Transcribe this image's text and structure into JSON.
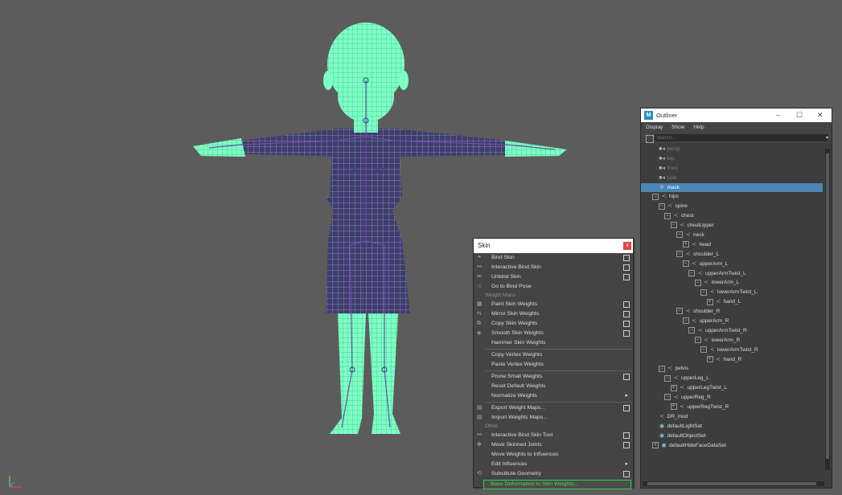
{
  "skin_menu": {
    "title": "Skin",
    "close_label": "x",
    "items": [
      {
        "label": "Bind Skin",
        "icon": "bind-skin-icon",
        "option": true
      },
      {
        "label": "Interactive Bind Skin",
        "icon": "interactive-bind-icon",
        "option": true
      },
      {
        "label": "Unbind Skin",
        "icon": "unbind-icon",
        "option": true
      },
      {
        "label": "Go to Bind Pose",
        "icon": "bind-pose-icon",
        "option": false
      }
    ],
    "section_weight_maps": "Weight Maps",
    "weight_items": [
      {
        "label": "Paint Skin Weights",
        "icon": "paint-weights-icon",
        "option": true
      },
      {
        "label": "Mirror Skin Weights",
        "icon": "mirror-weights-icon",
        "option": true
      },
      {
        "label": "Copy Skin Weights",
        "icon": "copy-weights-icon",
        "option": true
      },
      {
        "label": "Smooth Skin Weights",
        "icon": "smooth-weights-icon",
        "option": true
      },
      {
        "label": "Hammer Skin Weights",
        "icon": "",
        "option": false
      }
    ],
    "vertex_items": [
      {
        "label": "Copy Vertex Weights",
        "option": false
      },
      {
        "label": "Paste Vertex Weights",
        "option": false
      }
    ],
    "prune_items": [
      {
        "label": "Prune Small Weights",
        "option": true,
        "submenu": false
      },
      {
        "label": "Reset Default Weights",
        "option": false,
        "submenu": false
      },
      {
        "label": "Normalize Weights",
        "option": false,
        "submenu": true
      }
    ],
    "export_items": [
      {
        "label": "Export Weight Maps...",
        "icon": "export-icon",
        "option": true
      },
      {
        "label": "Import Weights Maps...",
        "icon": "import-icon",
        "option": false
      }
    ],
    "section_other": "Other",
    "other_items": [
      {
        "label": "Interactive Bind Skin Tool",
        "icon": "bind-tool-icon",
        "option": true,
        "submenu": false
      },
      {
        "label": "Move Skinned Joints",
        "icon": "move-joints-icon",
        "option": true,
        "submenu": false
      },
      {
        "label": "Move Weights to Influences",
        "icon": "",
        "option": false,
        "submenu": false
      },
      {
        "label": "Edit Influences",
        "icon": "",
        "option": false,
        "submenu": true
      },
      {
        "label": "Substitute Geometry",
        "icon": "substitute-icon",
        "option": true,
        "submenu": false
      }
    ],
    "highlight_item": "Bake Deformation to Skin Weights..."
  },
  "outliner": {
    "title": "Outliner",
    "logo": "M",
    "window_buttons": {
      "minimize": "–",
      "maximize": "☐",
      "close": "✕"
    },
    "menu": [
      "Display",
      "Show",
      "Help"
    ],
    "search_placeholder": "Search...",
    "nodes": [
      {
        "label": "persp",
        "depth": 1,
        "type": "camera",
        "expander": "",
        "dim": true
      },
      {
        "label": "top",
        "depth": 1,
        "type": "camera",
        "expander": "",
        "dim": true
      },
      {
        "label": "front",
        "depth": 1,
        "type": "camera",
        "expander": "",
        "dim": true
      },
      {
        "label": "side",
        "depth": 1,
        "type": "camera",
        "expander": "",
        "dim": true
      },
      {
        "label": "mask",
        "depth": 1,
        "type": "locator",
        "expander": "",
        "selected": true
      },
      {
        "label": "hips",
        "depth": 0,
        "type": "joint",
        "expander": "−"
      },
      {
        "label": "spine",
        "depth": 1,
        "type": "joint",
        "expander": "−"
      },
      {
        "label": "chest",
        "depth": 2,
        "type": "joint",
        "expander": "−"
      },
      {
        "label": "chestUpper",
        "depth": 3,
        "type": "joint",
        "expander": "−"
      },
      {
        "label": "neck",
        "depth": 4,
        "type": "joint",
        "expander": "−"
      },
      {
        "label": "head",
        "depth": 5,
        "type": "joint",
        "expander": "+"
      },
      {
        "label": "shoulder_L",
        "depth": 4,
        "type": "joint",
        "expander": "−"
      },
      {
        "label": "upperArm_L",
        "depth": 5,
        "type": "joint",
        "expander": "−"
      },
      {
        "label": "upperArmTwist_L",
        "depth": 6,
        "type": "joint",
        "expander": "−"
      },
      {
        "label": "lowerArm_L",
        "depth": 7,
        "type": "joint",
        "expander": "−"
      },
      {
        "label": "lowerArmTwist_L",
        "depth": 8,
        "type": "joint",
        "expander": "−"
      },
      {
        "label": "hand_L",
        "depth": 9,
        "type": "joint",
        "expander": "+"
      },
      {
        "label": "shoulder_R",
        "depth": 4,
        "type": "joint",
        "expander": "−"
      },
      {
        "label": "upperArm_R",
        "depth": 5,
        "type": "joint",
        "expander": "−"
      },
      {
        "label": "upperArmTwist_R",
        "depth": 6,
        "type": "joint",
        "expander": "−"
      },
      {
        "label": "lowerArm_R",
        "depth": 7,
        "type": "joint",
        "expander": "−"
      },
      {
        "label": "lowerArmTwist_R",
        "depth": 8,
        "type": "joint",
        "expander": "−"
      },
      {
        "label": "hand_R",
        "depth": 9,
        "type": "joint",
        "expander": "+"
      },
      {
        "label": "pelvis",
        "depth": 1,
        "type": "joint",
        "expander": "−"
      },
      {
        "label": "upperLeg_L",
        "depth": 2,
        "type": "joint",
        "expander": "−"
      },
      {
        "label": "upperLegTwist_L",
        "depth": 3,
        "type": "joint",
        "expander": "+"
      },
      {
        "label": "upperReg_R",
        "depth": 2,
        "type": "joint",
        "expander": "−"
      },
      {
        "label": "upperRegTwist_R",
        "depth": 3,
        "type": "joint",
        "expander": "+"
      },
      {
        "label": "DR_mod",
        "depth": 1,
        "type": "joint",
        "expander": ""
      },
      {
        "label": "defaultLightSet",
        "depth": 1,
        "type": "set",
        "expander": ""
      },
      {
        "label": "defaultObjectSet",
        "depth": 1,
        "type": "set",
        "expander": ""
      },
      {
        "label": "defaultHideFaceDataSet",
        "depth": 0,
        "type": "set",
        "expander": "+"
      }
    ]
  },
  "viewport": {
    "background": "#5c5c5c",
    "mesh_color": "#7dffc4",
    "cloth_color": "#3f3d6e"
  }
}
